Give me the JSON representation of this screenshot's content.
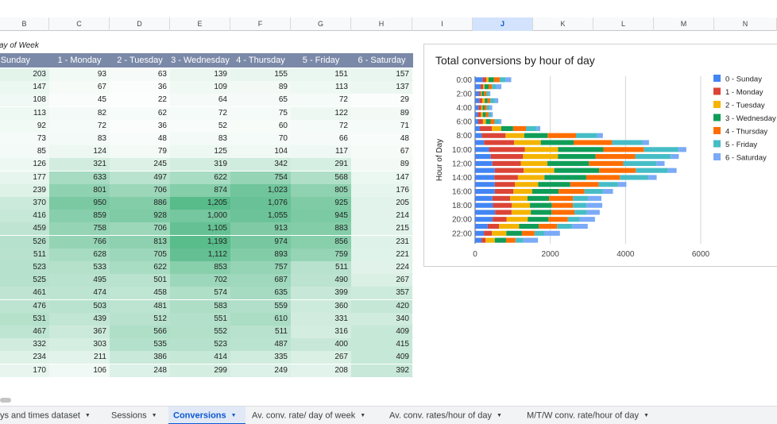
{
  "columns": [
    {
      "letter": "B",
      "selected": false
    },
    {
      "letter": "C",
      "selected": false
    },
    {
      "letter": "D",
      "selected": false
    },
    {
      "letter": "E",
      "selected": false
    },
    {
      "letter": "F",
      "selected": false
    },
    {
      "letter": "G",
      "selected": false
    },
    {
      "letter": "H",
      "selected": false
    },
    {
      "letter": "I",
      "selected": false
    },
    {
      "letter": "J",
      "selected": true
    },
    {
      "letter": "K",
      "selected": false
    },
    {
      "letter": "L",
      "selected": false
    },
    {
      "letter": "M",
      "selected": false
    },
    {
      "letter": "N",
      "selected": false
    }
  ],
  "table": {
    "title": "ay of Week",
    "headers": [
      "Sunday",
      "1 - Monday",
      "2 - Tuesday",
      "3 - Wednesday",
      "4 - Thursday",
      "5 - Friday",
      "6 - Saturday"
    ],
    "rows": [
      [
        "203",
        "93",
        "63",
        "139",
        "155",
        "151",
        "157"
      ],
      [
        "147",
        "67",
        "36",
        "109",
        "89",
        "113",
        "137"
      ],
      [
        "108",
        "45",
        "22",
        "64",
        "65",
        "72",
        "29"
      ],
      [
        "113",
        "82",
        "62",
        "72",
        "75",
        "122",
        "89"
      ],
      [
        "92",
        "72",
        "36",
        "52",
        "60",
        "72",
        "71"
      ],
      [
        "73",
        "83",
        "48",
        "83",
        "70",
        "66",
        "48"
      ],
      [
        "85",
        "124",
        "79",
        "125",
        "104",
        "117",
        "67"
      ],
      [
        "126",
        "321",
        "245",
        "319",
        "342",
        "291",
        "89"
      ],
      [
        "177",
        "633",
        "497",
        "622",
        "754",
        "568",
        "147"
      ],
      [
        "239",
        "801",
        "706",
        "874",
        "1,023",
        "805",
        "176"
      ],
      [
        "370",
        "950",
        "886",
        "1,205",
        "1,076",
        "925",
        "205"
      ],
      [
        "416",
        "859",
        "928",
        "1,000",
        "1,055",
        "945",
        "214"
      ],
      [
        "459",
        "758",
        "706",
        "1,105",
        "913",
        "883",
        "215"
      ],
      [
        "526",
        "766",
        "813",
        "1,193",
        "974",
        "856",
        "231"
      ],
      [
        "511",
        "628",
        "705",
        "1,112",
        "893",
        "759",
        "221"
      ],
      [
        "523",
        "533",
        "622",
        "853",
        "757",
        "511",
        "224"
      ],
      [
        "525",
        "495",
        "501",
        "702",
        "687",
        "490",
        "267"
      ],
      [
        "461",
        "474",
        "458",
        "574",
        "635",
        "399",
        "357"
      ],
      [
        "476",
        "503",
        "481",
        "583",
        "559",
        "360",
        "420"
      ],
      [
        "531",
        "439",
        "512",
        "551",
        "610",
        "331",
        "340"
      ],
      [
        "467",
        "367",
        "566",
        "552",
        "511",
        "316",
        "409"
      ],
      [
        "332",
        "303",
        "535",
        "523",
        "487",
        "400",
        "415"
      ],
      [
        "234",
        "211",
        "386",
        "414",
        "335",
        "267",
        "409"
      ],
      [
        "170",
        "106",
        "248",
        "299",
        "249",
        "208",
        "392"
      ]
    ]
  },
  "chart_data": {
    "type": "bar",
    "orientation": "horizontal",
    "stacked": true,
    "title": "Total conversions by hour of day",
    "ylabel": "Hour of Day",
    "xlabel": "",
    "xlim": [
      0,
      6000
    ],
    "xticks": [
      "0",
      "2000",
      "4000",
      "6000"
    ],
    "categories": [
      "0:00",
      "1:00",
      "2:00",
      "3:00",
      "4:00",
      "5:00",
      "6:00",
      "7:00",
      "8:00",
      "9:00",
      "10:00",
      "11:00",
      "12:00",
      "13:00",
      "14:00",
      "15:00",
      "16:00",
      "17:00",
      "18:00",
      "19:00",
      "20:00",
      "21:00",
      "22:00",
      "23:00"
    ],
    "category_labels": [
      "0:00",
      "",
      "2:00",
      "",
      "4:00",
      "",
      "6:00",
      "",
      "8:00",
      "",
      "10:00",
      "",
      "12:00",
      "",
      "14:00",
      "",
      "16:00",
      "",
      "18:00",
      "",
      "20:00",
      "",
      "22:00",
      ""
    ],
    "legend_position": "right",
    "grid": true,
    "series": [
      {
        "name": "0 - Sunday",
        "color": "#4285f4",
        "values": [
          203,
          147,
          108,
          113,
          92,
          73,
          85,
          126,
          177,
          239,
          370,
          416,
          459,
          526,
          511,
          523,
          525,
          461,
          476,
          531,
          467,
          332,
          234,
          170
        ]
      },
      {
        "name": "1 - Monday",
        "color": "#db4437",
        "values": [
          93,
          67,
          45,
          82,
          72,
          83,
          124,
          321,
          633,
          801,
          950,
          859,
          758,
          766,
          628,
          533,
          495,
          474,
          503,
          439,
          367,
          303,
          211,
          106
        ]
      },
      {
        "name": "2 - Tuesday",
        "color": "#f4b400",
        "values": [
          63,
          36,
          22,
          62,
          36,
          48,
          79,
          245,
          497,
          706,
          886,
          928,
          706,
          813,
          705,
          622,
          501,
          458,
          481,
          512,
          566,
          535,
          386,
          248
        ]
      },
      {
        "name": "3 - Wednesday",
        "color": "#0f9d58",
        "values": [
          139,
          109,
          64,
          72,
          52,
          83,
          125,
          319,
          622,
          874,
          1205,
          1000,
          1105,
          1193,
          1112,
          853,
          702,
          574,
          583,
          551,
          552,
          523,
          414,
          299
        ]
      },
      {
        "name": "4 - Thursday",
        "color": "#ff6d00",
        "values": [
          155,
          89,
          65,
          75,
          60,
          70,
          104,
          342,
          754,
          1023,
          1076,
          1055,
          913,
          974,
          893,
          757,
          687,
          635,
          559,
          610,
          511,
          487,
          335,
          249
        ]
      },
      {
        "name": "5 - Friday",
        "color": "#46bdc6",
        "values": [
          151,
          113,
          72,
          122,
          72,
          66,
          117,
          291,
          568,
          805,
          925,
          945,
          883,
          856,
          759,
          511,
          490,
          399,
          360,
          331,
          316,
          400,
          267,
          208
        ]
      },
      {
        "name": "6 - Saturday",
        "color": "#7baaf7",
        "values": [
          157,
          137,
          29,
          89,
          71,
          48,
          67,
          89,
          147,
          176,
          205,
          214,
          215,
          231,
          221,
          224,
          267,
          357,
          420,
          340,
          409,
          415,
          409,
          392
        ]
      }
    ]
  },
  "heat": {
    "low": "#ffffff",
    "high": "#57bb8a",
    "max": 1205
  },
  "tabs": [
    {
      "label": "ys and times dataset",
      "active": false
    },
    {
      "label": "Sessions",
      "active": false
    },
    {
      "label": "Conversions",
      "active": true
    },
    {
      "label": "Av. conv. rate/ day of week",
      "active": false
    },
    {
      "label": "Av. conv. rates/hour of day",
      "active": false
    },
    {
      "label": "M/T/W conv. rate/hour of day",
      "active": false
    }
  ],
  "caret_icon": "▼"
}
